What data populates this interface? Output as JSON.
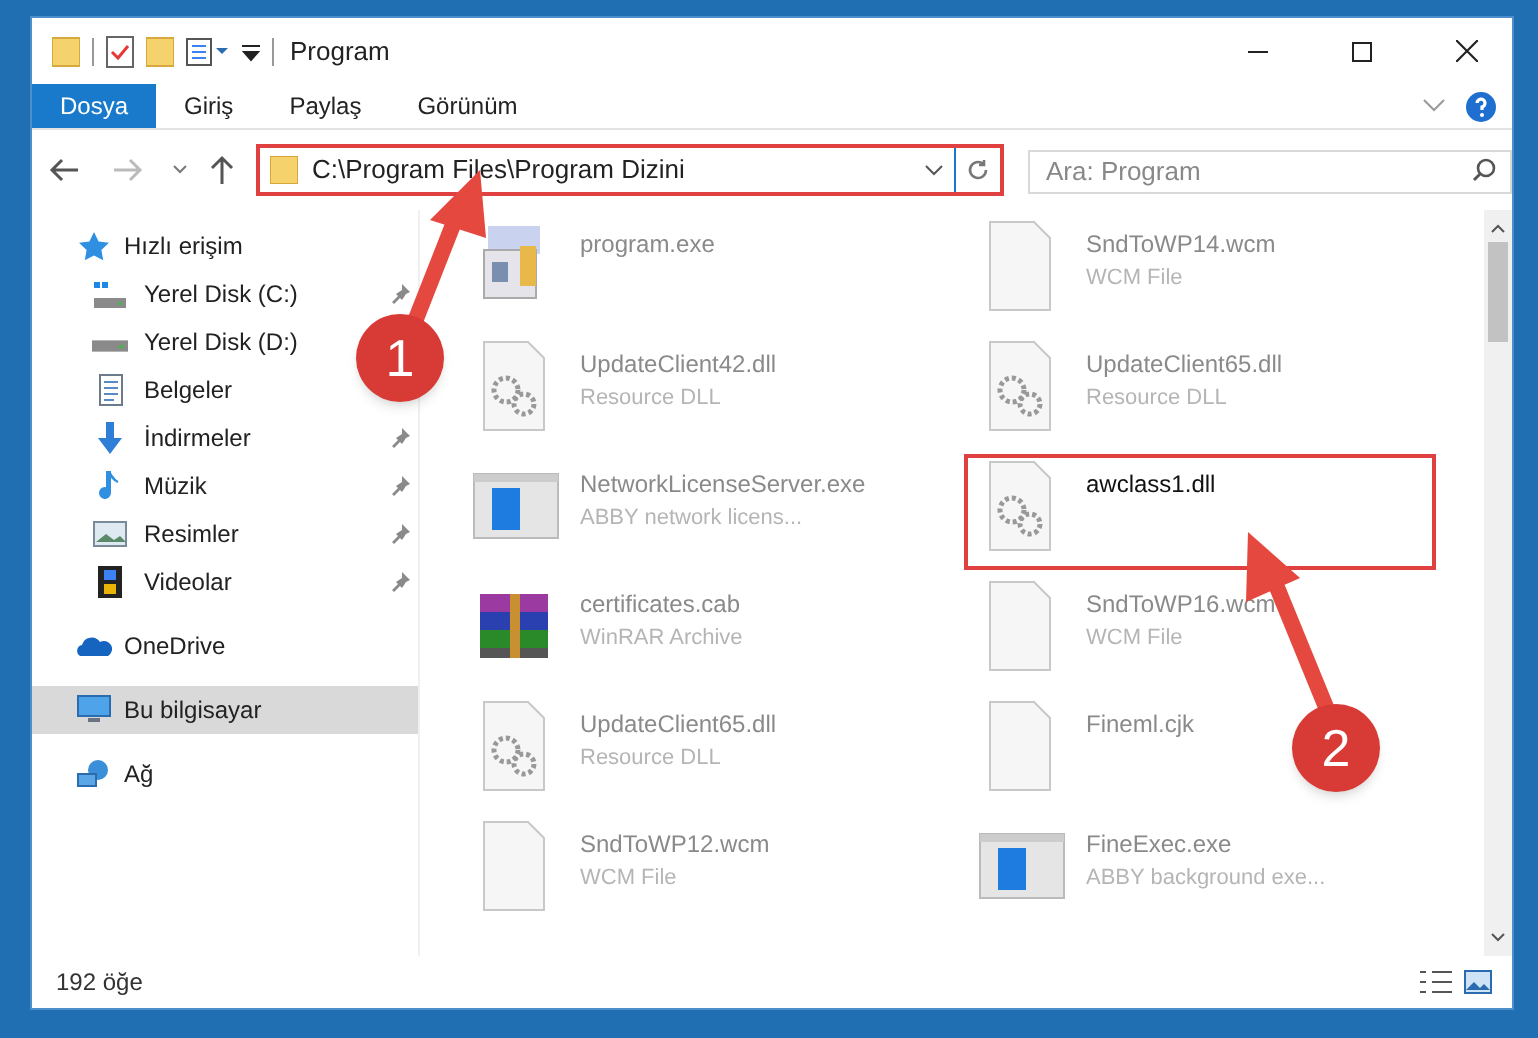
{
  "window": {
    "title": "Program"
  },
  "ribbon_tabs": [
    {
      "label": "Dosya",
      "selected": true
    },
    {
      "label": "Giriş",
      "selected": false
    },
    {
      "label": "Paylaş",
      "selected": false
    },
    {
      "label": "Görünüm",
      "selected": false
    }
  ],
  "address": {
    "path": "C:\\Program Files\\Program Dizini"
  },
  "search": {
    "placeholder": "Ara: Program"
  },
  "sidebar": {
    "items": [
      {
        "label": "Hızlı erişim",
        "kind": "star",
        "selected": false,
        "children": [
          {
            "label": "Yerel Disk (C:)",
            "kind": "disk-c",
            "pinned": true
          },
          {
            "label": "Yerel Disk (D:)",
            "kind": "disk",
            "pinned": false
          },
          {
            "label": "Belgeler",
            "kind": "document",
            "pinned": false
          },
          {
            "label": "İndirmeler",
            "kind": "download",
            "pinned": true
          },
          {
            "label": "Müzik",
            "kind": "music",
            "pinned": true
          },
          {
            "label": "Resimler",
            "kind": "image",
            "pinned": true
          },
          {
            "label": "Videolar",
            "kind": "video",
            "pinned": true
          }
        ]
      },
      {
        "label": "OneDrive",
        "kind": "cloud",
        "selected": false
      },
      {
        "label": "Bu bilgisayar",
        "kind": "computer",
        "selected": true
      },
      {
        "label": "Ağ",
        "kind": "network",
        "selected": false
      }
    ]
  },
  "files": [
    {
      "name": "program.exe",
      "kind": "installer",
      "blurred": true
    },
    {
      "name": "SndToWP14.wcm",
      "type": "WCM File",
      "kind": "blank",
      "blurred": true
    },
    {
      "name": "UpdateClient42.dll",
      "type": "Resource DLL",
      "kind": "dll",
      "blurred": true
    },
    {
      "name": "UpdateClient65.dll",
      "type": "Resource DLL",
      "kind": "dll",
      "blurred": true
    },
    {
      "name": "NetworkLicenseServer.exe",
      "type": "ABBY network licens...",
      "kind": "window",
      "blurred": true
    },
    {
      "name": "awclass1.dll",
      "kind": "dll",
      "blurred": false
    },
    {
      "name": "certificates.cab",
      "type": "WinRAR Archive",
      "kind": "archive",
      "blurred": true
    },
    {
      "name": "SndToWP16.wcm",
      "type": "WCM File",
      "kind": "blank",
      "blurred": true
    },
    {
      "name": "UpdateClient65.dll",
      "type": "Resource DLL",
      "kind": "dll",
      "blurred": true
    },
    {
      "name": "Fineml.cjk",
      "kind": "blank",
      "blurred": true
    },
    {
      "name": "SndToWP12.wcm",
      "type": "WCM File",
      "kind": "blank",
      "blurred": true
    },
    {
      "name": "FineExec.exe",
      "type": "ABBY background exe...",
      "kind": "window",
      "blurred": true
    }
  ],
  "status_bar": {
    "count": "192 öğe"
  },
  "annotations": [
    {
      "number": "1"
    },
    {
      "number": "2"
    }
  ]
}
